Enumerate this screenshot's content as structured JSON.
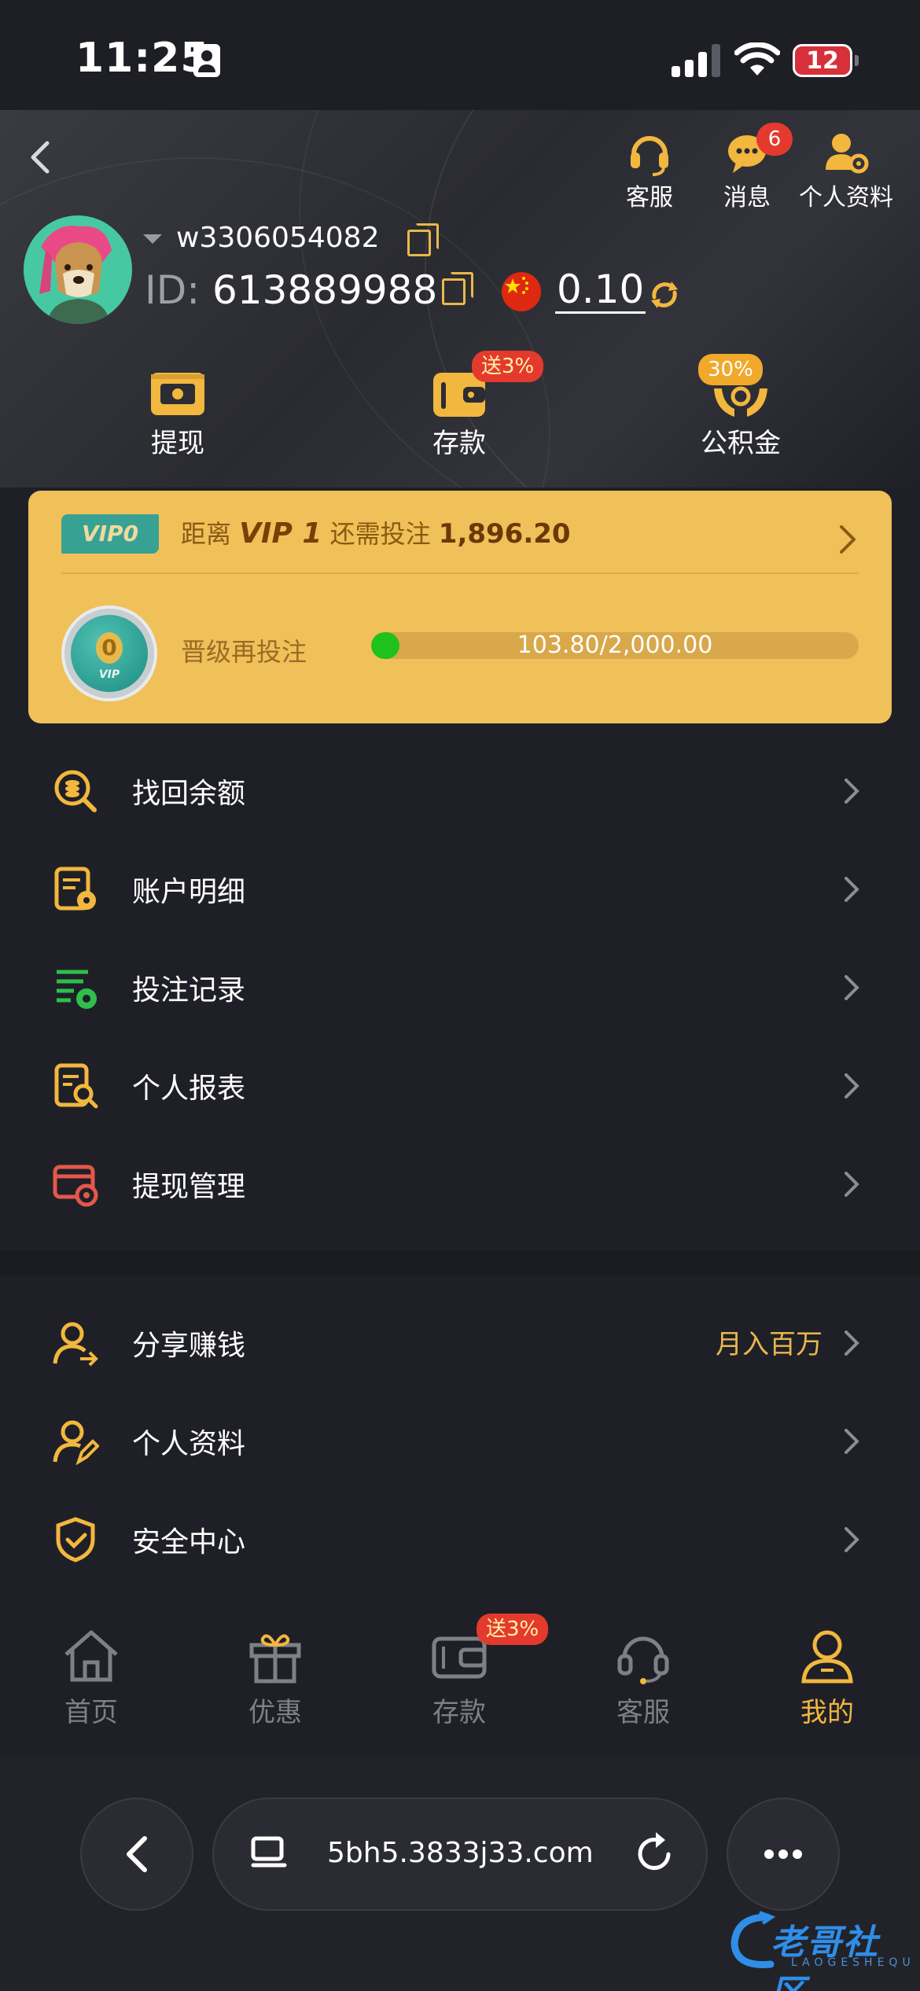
{
  "status": {
    "time": "11:25",
    "battery": "12"
  },
  "header": {
    "actions": [
      {
        "label": "客服"
      },
      {
        "label": "消息",
        "badge": "6"
      },
      {
        "label": "个人资料"
      }
    ],
    "username": "w3306054082",
    "id_label": "ID:",
    "id_value": "613889988",
    "balance": "0.10",
    "quick": [
      {
        "label": "提现"
      },
      {
        "label": "存款",
        "badge": "送3%"
      },
      {
        "label": "公积金",
        "badge": "30%"
      }
    ]
  },
  "vip": {
    "tag": "VIP0",
    "prefix": "距离",
    "level": "VIP 1",
    "mid": "还需投注",
    "amount": "1,896.20",
    "medal_level": "0",
    "medal_text": "VIP",
    "upgrade_label": "晋级再投注",
    "progress_text": "103.80/2,000.00",
    "progress_fraction": 0.0519
  },
  "menu1": [
    {
      "label": "找回余额",
      "icon": "search-coin-icon"
    },
    {
      "label": "账户明细",
      "icon": "account-detail-icon"
    },
    {
      "label": "投注记录",
      "icon": "bet-record-icon"
    },
    {
      "label": "个人报表",
      "icon": "report-icon"
    },
    {
      "label": "提现管理",
      "icon": "withdraw-manage-icon"
    }
  ],
  "menu2": [
    {
      "label": "分享赚钱",
      "extra": "月入百万",
      "icon": "share-earn-icon"
    },
    {
      "label": "个人资料",
      "extra": "",
      "icon": "profile-edit-icon"
    },
    {
      "label": "安全中心",
      "extra": "",
      "icon": "shield-icon"
    }
  ],
  "nav": [
    {
      "label": "首页"
    },
    {
      "label": "优惠"
    },
    {
      "label": "存款",
      "badge": "送3%"
    },
    {
      "label": "客服"
    },
    {
      "label": "我的"
    }
  ],
  "browser": {
    "url": "5bh5.3833j33.com"
  },
  "watermark": {
    "text": "老哥社区",
    "sub": "LAOGESHEQU"
  },
  "colors": {
    "accent": "#f2b73e",
    "vip_card": "#f0c059",
    "badge_red": "#e43a2e",
    "progress": "#1ec21a",
    "bg": "#1f2027"
  }
}
